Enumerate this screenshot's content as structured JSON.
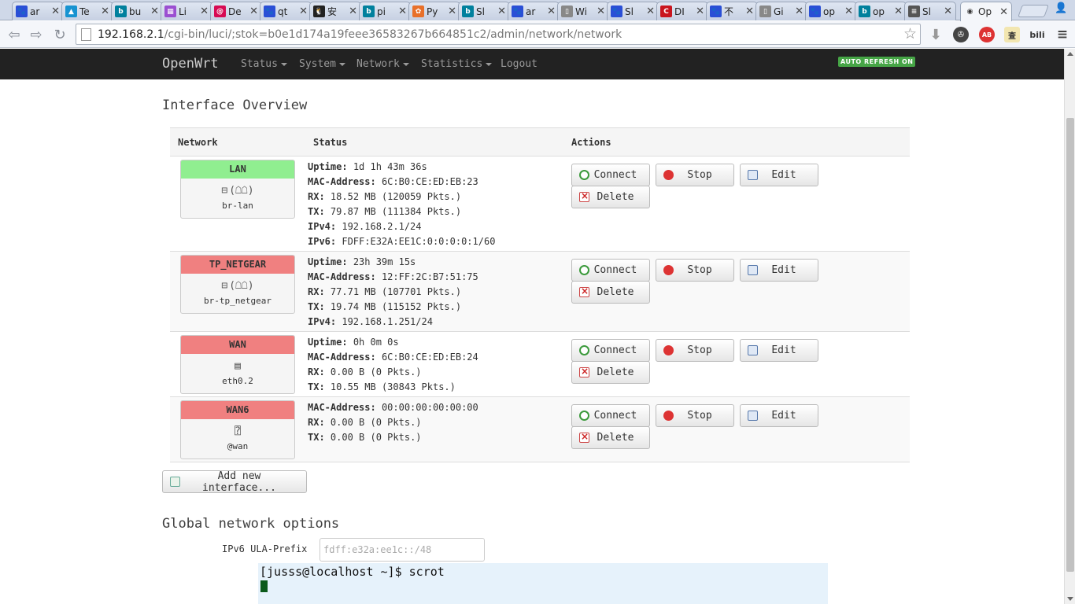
{
  "browser": {
    "tabs": [
      {
        "title": "ar",
        "favicon": "baidu-paw-icon",
        "color": "#2a4fd6",
        "glyph": "🐾"
      },
      {
        "title": "Te",
        "favicon": "arch-icon",
        "color": "#1793d1",
        "glyph": "▲"
      },
      {
        "title": "bu",
        "favicon": "bing-icon",
        "color": "#00809d",
        "glyph": "b"
      },
      {
        "title": "Li",
        "favicon": "grid-icon",
        "color": "#9b4fd1",
        "glyph": "▦"
      },
      {
        "title": "De",
        "favicon": "debian-icon",
        "color": "#d70a53",
        "glyph": "@"
      },
      {
        "title": "qt",
        "favicon": "baidu-paw-icon",
        "color": "#2a4fd6",
        "glyph": "🐾"
      },
      {
        "title": "安",
        "favicon": "penguin-icon",
        "color": "#222222",
        "glyph": "🐧"
      },
      {
        "title": "pi",
        "favicon": "bing-icon",
        "color": "#00809d",
        "glyph": "b"
      },
      {
        "title": "Py",
        "favicon": "fire-icon",
        "color": "#e8702a",
        "glyph": "✿"
      },
      {
        "title": "Sl",
        "favicon": "bing-icon",
        "color": "#00809d",
        "glyph": "b"
      },
      {
        "title": "ar",
        "favicon": "baidu-paw-icon",
        "color": "#2a4fd6",
        "glyph": "🐾"
      },
      {
        "title": "Wi",
        "favicon": "page-icon",
        "color": "#888888",
        "glyph": "▯"
      },
      {
        "title": "Sl",
        "favicon": "baidu-paw-icon",
        "color": "#2a4fd6",
        "glyph": "🐾"
      },
      {
        "title": "DI",
        "favicon": "csdn-icon",
        "color": "#c9151e",
        "glyph": "C"
      },
      {
        "title": "不",
        "favicon": "baidu-paw-icon",
        "color": "#2a4fd6",
        "glyph": "🐾"
      },
      {
        "title": "Gi",
        "favicon": "page-icon",
        "color": "#888888",
        "glyph": "▯"
      },
      {
        "title": "op",
        "favicon": "baidu-paw-icon",
        "color": "#2a4fd6",
        "glyph": "🐾"
      },
      {
        "title": "op",
        "favicon": "bing-icon",
        "color": "#00809d",
        "glyph": "b"
      },
      {
        "title": "Sl",
        "favicon": "openwrt-logo-icon",
        "color": "#555555",
        "glyph": "≡"
      },
      {
        "title": "Op",
        "favicon": "openwrt-wifi-icon",
        "color": "#555555",
        "glyph": "◉",
        "active": true
      }
    ],
    "url_host": "192.168.2.1",
    "url_path": "/cgi-bin/luci/;stok=b0e1d174a19feee36583267b664851c2/admin/network/network"
  },
  "header": {
    "brand": "OpenWrt",
    "menu": [
      {
        "label": "Status",
        "dropdown": true
      },
      {
        "label": "System",
        "dropdown": true
      },
      {
        "label": "Network",
        "dropdown": true
      },
      {
        "label": "Statistics",
        "dropdown": true
      },
      {
        "label": "Logout",
        "dropdown": false
      }
    ],
    "auto_refresh": "AUTO REFRESH ON"
  },
  "interfaces_section": {
    "title": "Interface Overview",
    "columns": [
      "Network",
      "Status",
      "Actions"
    ],
    "actions": {
      "connect": "Connect",
      "stop": "Stop",
      "edit": "Edit",
      "delete": "Delete"
    },
    "rows": [
      {
        "name": "LAN",
        "color": "#90ee90",
        "device": "br-lan",
        "icons": [
          "ethernet-icon",
          "bridge-icon"
        ],
        "status": [
          {
            "k": "Uptime:",
            "v": "1d 1h 43m 36s"
          },
          {
            "k": "MAC-Address:",
            "v": "6C:B0:CE:ED:EB:23"
          },
          {
            "k": "RX:",
            "v": "18.52 MB (120059 Pkts.)"
          },
          {
            "k": "TX:",
            "v": "79.87 MB (111384 Pkts.)"
          },
          {
            "k": "IPv4:",
            "v": "192.168.2.1/24"
          },
          {
            "k": "IPv6:",
            "v": "FDFF:E32A:EE1C:0:0:0:0:1/60"
          }
        ]
      },
      {
        "name": "TP_NETGEAR",
        "color": "#f08080",
        "device": "br-tp_netgear",
        "icons": [
          "ethernet-icon",
          "bridge-icon"
        ],
        "status": [
          {
            "k": "Uptime:",
            "v": "23h 39m 15s"
          },
          {
            "k": "MAC-Address:",
            "v": "12:FF:2C:B7:51:75"
          },
          {
            "k": "RX:",
            "v": "77.71 MB (107701 Pkts.)"
          },
          {
            "k": "TX:",
            "v": "19.74 MB (115152 Pkts.)"
          },
          {
            "k": "IPv4:",
            "v": "192.168.1.251/24"
          }
        ]
      },
      {
        "name": "WAN",
        "color": "#f08080",
        "device": "eth0.2",
        "icons": [
          "switch-port-icon"
        ],
        "status": [
          {
            "k": "Uptime:",
            "v": "0h 0m 0s"
          },
          {
            "k": "MAC-Address:",
            "v": "6C:B0:CE:ED:EB:24"
          },
          {
            "k": "RX:",
            "v": "0.00 B (0 Pkts.)"
          },
          {
            "k": "TX:",
            "v": "10.55 MB (30843 Pkts.)"
          }
        ]
      },
      {
        "name": "WAN6",
        "color": "#f08080",
        "device": "@wan",
        "icons": [
          "alias-icon"
        ],
        "status": [
          {
            "k": "MAC-Address:",
            "v": "00:00:00:00:00:00"
          },
          {
            "k": "RX:",
            "v": "0.00 B (0 Pkts.)"
          },
          {
            "k": "TX:",
            "v": "0.00 B (0 Pkts.)"
          }
        ]
      }
    ],
    "add_button": "Add new interface..."
  },
  "global_section": {
    "title": "Global network options",
    "ula_label": "IPv6 ULA-Prefix",
    "ula_placeholder": "fdff:e32a:ee1c::/48"
  },
  "terminal": {
    "prompt_line": "[jusss@localhost ~]$ scrot"
  }
}
